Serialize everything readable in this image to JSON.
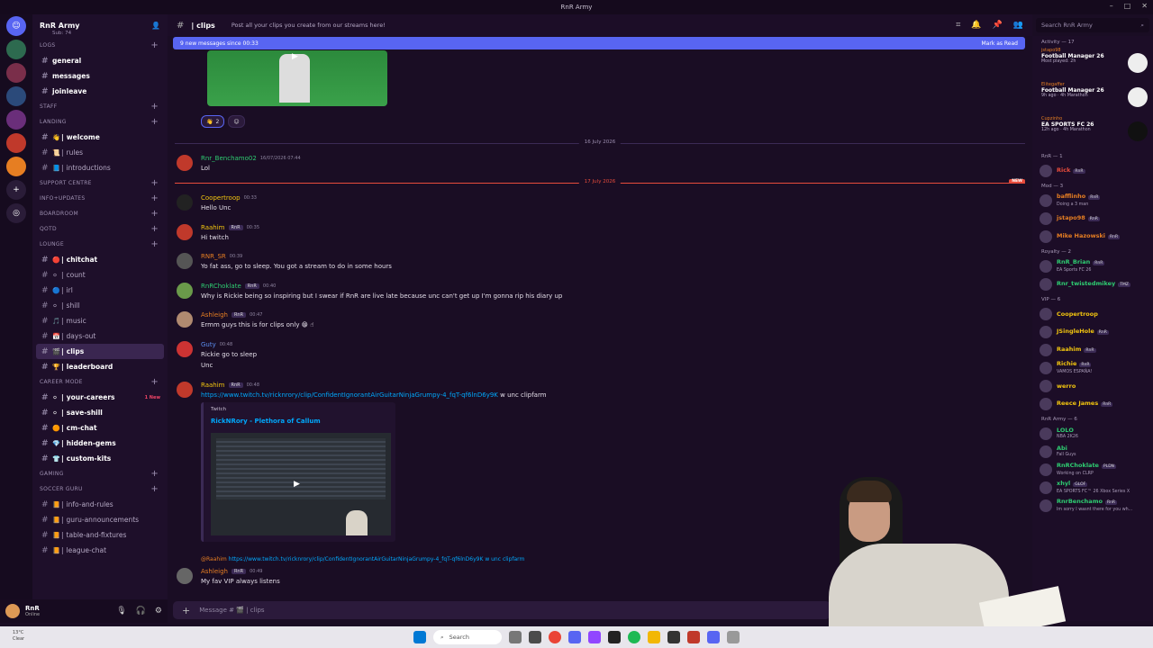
{
  "window": {
    "title": "RnR Army"
  },
  "server": {
    "name": "RnR Army",
    "top_text": "Sub: 74"
  },
  "channel_categories": [
    {
      "key": "logs",
      "label": "LOGS"
    },
    {
      "key": "staff",
      "label": "STAFF"
    },
    {
      "key": "landing",
      "label": "LANDING"
    },
    {
      "key": "support",
      "label": "SUPPORT CENTRE"
    },
    {
      "key": "info",
      "label": "INFO+UPDATES"
    },
    {
      "key": "boardroom",
      "label": "BOARDROOM"
    },
    {
      "key": "qotd",
      "label": "QOTD"
    },
    {
      "key": "lounge",
      "label": "LOUNGE"
    },
    {
      "key": "career",
      "label": "CAREER MODE"
    },
    {
      "key": "gaming",
      "label": "GAMING"
    },
    {
      "key": "soccer",
      "label": "SOCCER GURU"
    }
  ],
  "channels": {
    "logs": [
      "general",
      "messages",
      "joinleave"
    ],
    "landing": [
      "welcome",
      "rules",
      "introductions"
    ],
    "lounge": [
      "chitchat",
      "count",
      "irl",
      "shill",
      "music",
      "days-out",
      "clips",
      "leaderboard"
    ],
    "career": [
      "your-careers",
      "save-shill",
      "cm-chat",
      "hidden-gems",
      "custom-kits"
    ],
    "soccer": [
      "info-and-rules",
      "guru-announcements",
      "table-and-fixtures",
      "league-chat"
    ]
  },
  "career_new_badge": "1 New",
  "user": {
    "name": "RnR",
    "status": "Online"
  },
  "header": {
    "channel": "| clips",
    "topic": "Post all your clips you create from our streams here!"
  },
  "search": {
    "placeholder": "Search RnR Army"
  },
  "newbar": {
    "text": "9 new messages since 00:33",
    "action": "Mark as Read"
  },
  "reaction": {
    "emoji": "👋",
    "count": "2"
  },
  "dividers": {
    "date1": "16 July 2026",
    "date2": "17 July 2026",
    "new_tag": "NEW"
  },
  "messages": [
    {
      "author": "Rnr_Benchamo02",
      "time": "16/07/2026 07:44",
      "color": "#2ecc71",
      "lines": [
        "Lol"
      ]
    },
    {
      "author": "Coopertroop",
      "time": "00:33",
      "color": "#f1c40f",
      "lines": [
        "Hello Unc"
      ]
    },
    {
      "author": "Raahim",
      "badge": "RnR",
      "time": "00:35",
      "color": "#f1c40f",
      "lines": [
        "Hi twitch"
      ]
    },
    {
      "author": "RNR_SR",
      "time": "00:39",
      "color": "#e67e22",
      "lines": [
        "Yo fat ass, go to sleep. You got a stream to do in some hours"
      ]
    },
    {
      "author": "RnRChoklate",
      "badge": "RnR",
      "time": "00:40",
      "color": "#2ecc71",
      "lines": [
        "Why is Rickie being so inspiring but I swear if RnR are live late because unc can't get up I'm gonna rip his diary up"
      ]
    },
    {
      "author": "Ashleigh",
      "badge": "RnR",
      "time": "00:47",
      "color": "#e67e22",
      "lines": [
        "Ermm guys this is for clips only 😁 ☝"
      ]
    },
    {
      "author": "Guty",
      "time": "00:48",
      "color": "#5b8def",
      "lines": [
        "Rickie go to sleep",
        "Unc"
      ]
    },
    {
      "author": "Raahim",
      "badge": "RnR",
      "time": "00:48",
      "color": "#f1c40f",
      "link": "https://www.twitch.tv/ricknrory/clip/ConfidentIgnorantAirGuitarNinjaGrumpy-4_fqT-qf6lnD6y9K",
      "tail": " w unc clipfarm"
    },
    {
      "author": "Ashleigh",
      "badge": "RnR",
      "time": "00:49",
      "color": "#e67e22",
      "lines": [
        "My fav VIP always listens"
      ]
    }
  ],
  "reply_preview": {
    "author": "@Raahim",
    "text": "https://www.twitch.tv/ricknrory/clip/ConfidentIgnorantAirGuitarNinjaGrumpy-4_fqT-qf6lnD6y9K w unc clipfarm"
  },
  "embed": {
    "provider": "Twitch",
    "title": "RickNRory - Plethora of Callum"
  },
  "composer": {
    "placeholder": "Message # 🎬 | clips"
  },
  "members": {
    "activity_header": "Activity — 17",
    "activities": [
      {
        "who": "jstapo98",
        "game": "Football Manager 26",
        "meta": "Most played: 2h"
      },
      {
        "who": "Elitegaffer",
        "game": "Football Manager 26",
        "meta": "9h ago · 4h Marathon"
      },
      {
        "who": "Cupzinho",
        "game": "EA SPORTS FC 26",
        "meta": "12h ago · 4h Marathon"
      }
    ],
    "groups": [
      {
        "title": "RnR — 1",
        "items": [
          {
            "name": "Rick",
            "color": "#e74c3c",
            "badge": "RnR"
          }
        ]
      },
      {
        "title": "Mod — 3",
        "items": [
          {
            "name": "bafflinho",
            "color": "#e67e22",
            "badge": "RnR",
            "status": "Doing a 3 man"
          },
          {
            "name": "jstapo98",
            "color": "#e67e22",
            "badge": "RnR"
          },
          {
            "name": "Mike Hazowski",
            "color": "#e67e22",
            "badge": "RnR"
          }
        ]
      },
      {
        "title": "Royalty — 2",
        "items": [
          {
            "name": "RnR_Brian",
            "color": "#2ecc71",
            "badge": "RnR",
            "status": "EA Sports FC 26"
          },
          {
            "name": "Rnr_twistedmikey",
            "color": "#2ecc71",
            "badge": "TMZ"
          }
        ]
      },
      {
        "title": "VIP — 6",
        "items": [
          {
            "name": "Coopertroop",
            "color": "#f1c40f"
          },
          {
            "name": "JSingleHole",
            "color": "#f1c40f",
            "badge": "RnR"
          },
          {
            "name": "Raahim",
            "color": "#f1c40f",
            "badge": "RnR"
          },
          {
            "name": "Richie",
            "color": "#f1c40f",
            "badge": "RnR",
            "status": "VAMOS ESPAÑA!"
          },
          {
            "name": "werro",
            "color": "#f1c40f"
          },
          {
            "name": "Reece James",
            "color": "#f1c40f",
            "badge": "RnR"
          }
        ]
      },
      {
        "title": "RnR Army — 6",
        "items": [
          {
            "name": "LOLO",
            "color": "#2ecc71",
            "status": "NBA 2K26"
          },
          {
            "name": "Abi",
            "color": "#2ecc71",
            "status": "Fall Guys"
          },
          {
            "name": "RnRChoklate",
            "color": "#2ecc71",
            "badge": "PLDN",
            "status": "Working on CLRP"
          },
          {
            "name": "xhyl",
            "color": "#2ecc71",
            "badge": "GLOF",
            "status": "EA SPORTS FC™ 26 Xbox Series X"
          },
          {
            "name": "RnrBenchamo",
            "color": "#2ecc71",
            "badge": "RnR",
            "status": "Im sorry I wasnt there for you wh..."
          }
        ]
      }
    ]
  },
  "taskbar": {
    "search": "Search",
    "weather_temp": "13°C",
    "weather_desc": "Clear"
  },
  "colors": {
    "accent": "#5865f2",
    "link": "#00a8fc",
    "new_red": "#e74c3c"
  }
}
